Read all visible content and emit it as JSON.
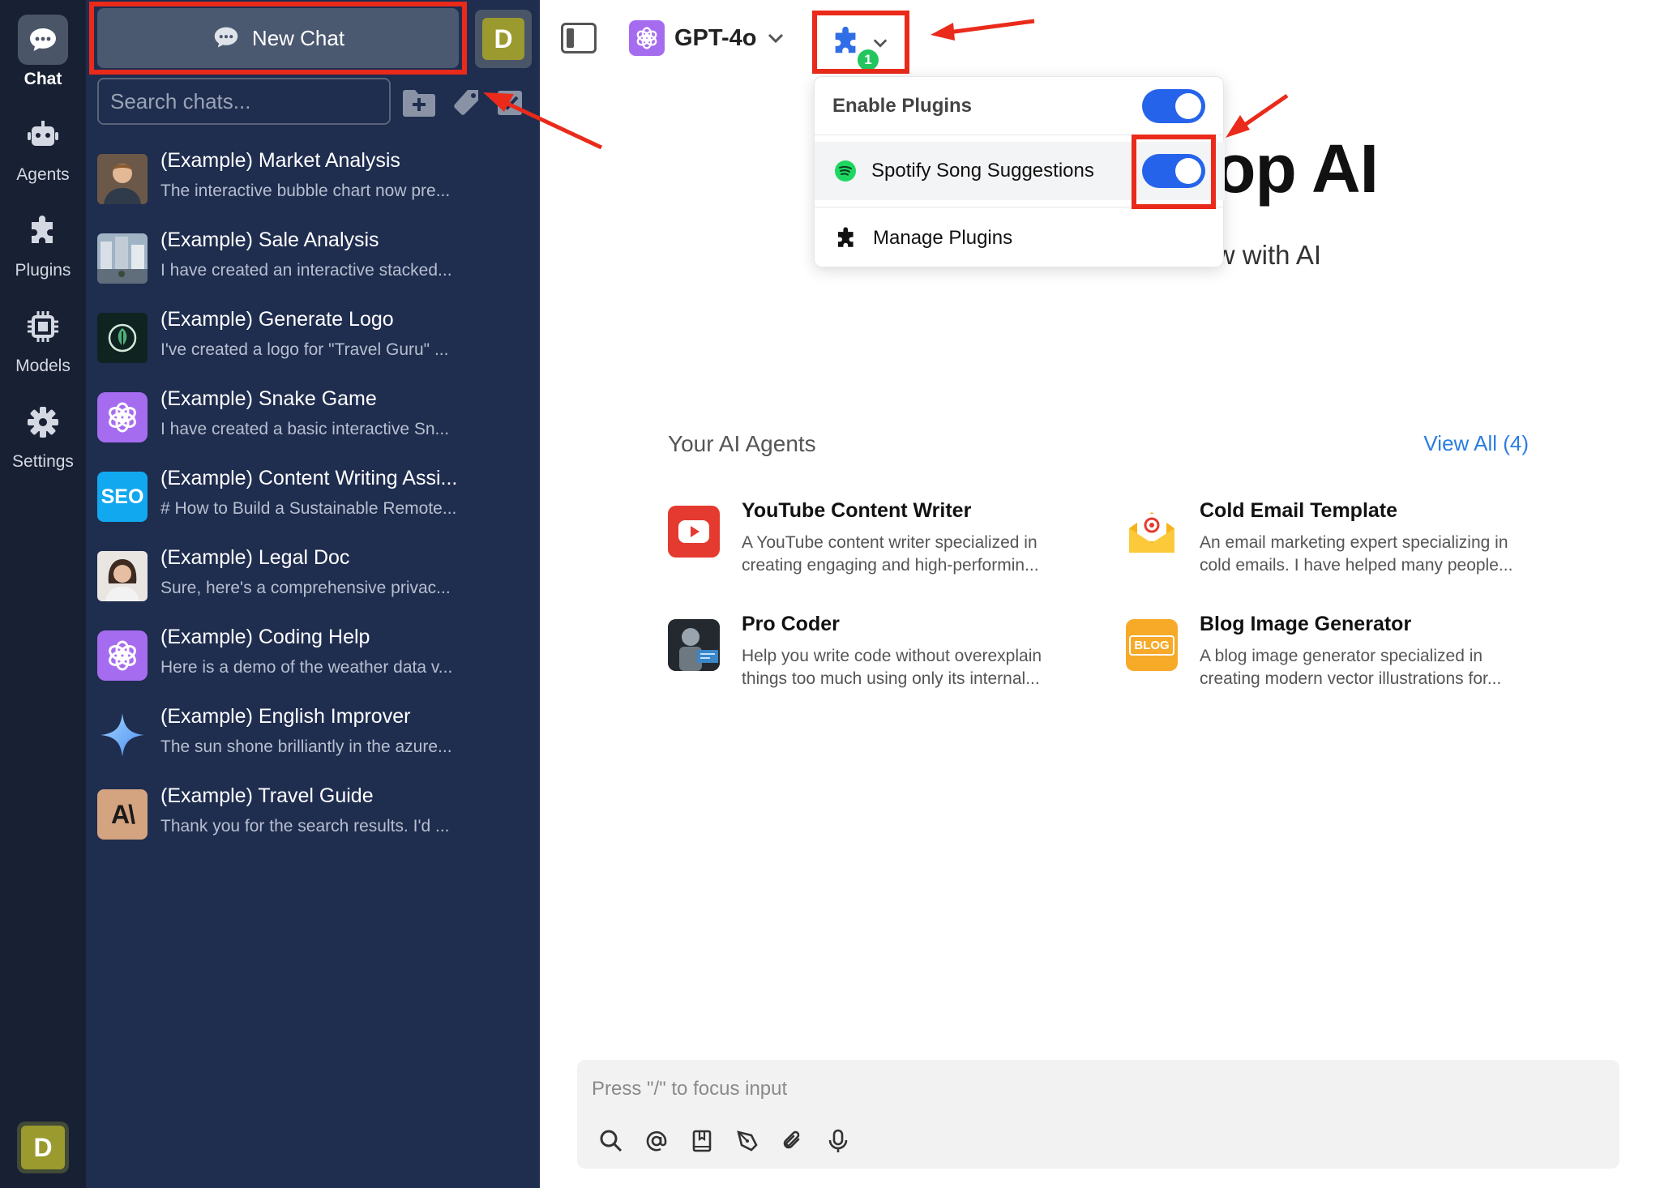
{
  "rail": {
    "items": [
      {
        "label": "Chat"
      },
      {
        "label": "Agents"
      },
      {
        "label": "Plugins"
      },
      {
        "label": "Models"
      },
      {
        "label": "Settings"
      }
    ],
    "avatar_initial": "D"
  },
  "panel": {
    "new_chat_label": "New Chat",
    "avatar_initial": "D",
    "search_placeholder": "Search chats...",
    "chats": [
      {
        "title": "(Example) Market Analysis",
        "preview": "The interactive bubble chart now pre..."
      },
      {
        "title": "(Example) Sale Analysis",
        "preview": "I have created an interactive stacked..."
      },
      {
        "title": "(Example) Generate Logo",
        "preview": "I've created a logo for \"Travel Guru\" ..."
      },
      {
        "title": "(Example) Snake Game",
        "preview": "I have created a basic interactive Sn..."
      },
      {
        "title": "(Example) Content Writing Assi...",
        "preview": "# How to Build a Sustainable Remote...",
        "icon_text": "SEO"
      },
      {
        "title": "(Example) Legal Doc",
        "preview": "Sure, here's a comprehensive privac..."
      },
      {
        "title": "(Example) Coding Help",
        "preview": "Here is a demo of the weather data v..."
      },
      {
        "title": "(Example) English Improver",
        "preview": "The sun shone brilliantly in the azure..."
      },
      {
        "title": "(Example) Travel Guide",
        "preview": "Thank you for the search results. I'd ...",
        "icon_text": "A\\"
      }
    ]
  },
  "topbar": {
    "model_name": "GPT-4o",
    "plugin_count": "1"
  },
  "hero": {
    "title_visible": "op AI",
    "subtitle_visible": "w with AI"
  },
  "dropdown": {
    "enable_label": "Enable Plugins",
    "plugin_name": "Spotify Song Suggestions",
    "manage_label": "Manage Plugins"
  },
  "agents": {
    "heading": "Your AI Agents",
    "view_all": "View All (4)",
    "items": [
      {
        "name": "YouTube Content Writer",
        "desc_line1": "A YouTube content writer specialized in",
        "desc_line2": "creating engaging and high-performin..."
      },
      {
        "name": "Cold Email Template",
        "desc_line1": "An email marketing expert specializing in",
        "desc_line2": "cold emails. I have helped many people..."
      },
      {
        "name": "Pro Coder",
        "desc_line1": "Help you write code without overexplain",
        "desc_line2": "things too much using only its internal..."
      },
      {
        "name": "Blog Image Generator",
        "desc_line1": "A blog image generator specialized in",
        "desc_line2": "creating modern vector illustrations for...",
        "icon_text": "BLOG"
      }
    ]
  },
  "composer": {
    "placeholder": "Press \"/\" to focus input"
  },
  "colors": {
    "rail_bg": "#182033",
    "panel_bg": "#1f2d4f",
    "accent_blue": "#2563eb",
    "highlight_red": "#ea2a1a",
    "spotify_green": "#1ed760"
  }
}
